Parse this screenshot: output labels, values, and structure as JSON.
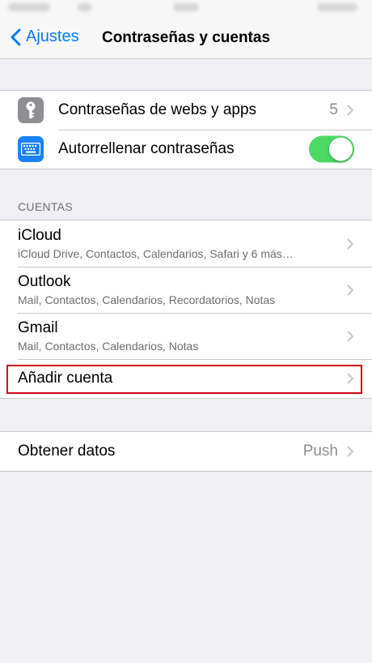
{
  "nav": {
    "back_label": "Ajustes",
    "title": "Contraseñas y cuentas"
  },
  "passwords_group": {
    "items": [
      {
        "label": "Contraseñas de webs y apps",
        "value": "5",
        "icon": "key-icon",
        "icon_color": "#8e8e93"
      },
      {
        "label": "Autorrellenar contraseñas",
        "toggle": true,
        "icon": "keyboard-icon",
        "icon_color": "#1a82fb"
      }
    ]
  },
  "accounts": {
    "header": "CUENTAS",
    "items": [
      {
        "title": "iCloud",
        "subtitle": "iCloud Drive, Contactos, Calendarios, Safari y 6 más…"
      },
      {
        "title": "Outlook",
        "subtitle": "Mail, Contactos, Calendarios, Recordatorios, Notas"
      },
      {
        "title": "Gmail",
        "subtitle": "Mail, Contactos, Calendarios, Notas"
      }
    ],
    "add_label": "Añadir cuenta"
  },
  "fetch": {
    "label": "Obtener datos",
    "value": "Push"
  },
  "colors": {
    "accent": "#007aff",
    "toggle_on": "#4cd964",
    "highlight": "#d0021b"
  }
}
